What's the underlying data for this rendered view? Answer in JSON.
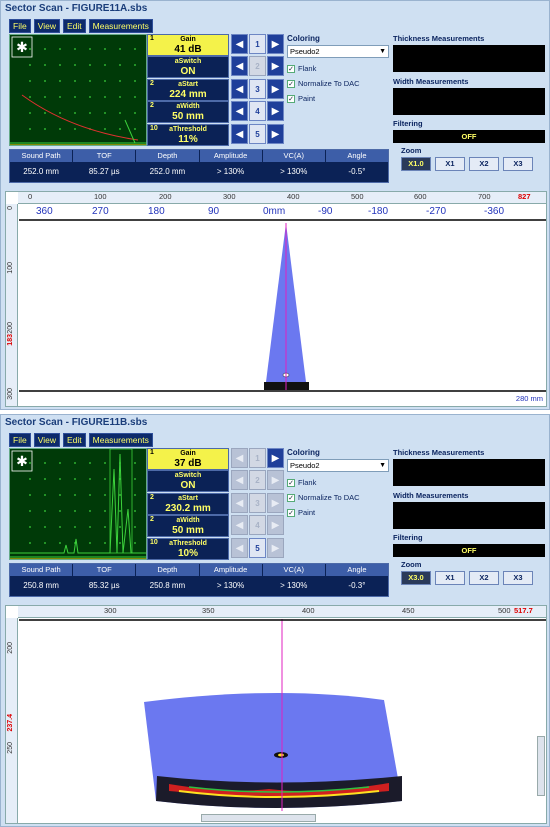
{
  "menu": [
    "File",
    "View",
    "Edit",
    "Measurements"
  ],
  "panels": [
    {
      "title": "Sector Scan - FIGURE11A.sbs",
      "params": [
        {
          "num": "1",
          "label": "Gain",
          "value": "41 dB"
        },
        {
          "num": "",
          "label": "aSwitch",
          "value": "ON"
        },
        {
          "num": "2",
          "label": "aStart",
          "value": "224 mm"
        },
        {
          "num": "2",
          "label": "aWidth",
          "value": "50 mm"
        },
        {
          "num": "10",
          "label": "aThreshold",
          "value": "11%"
        }
      ],
      "nav_digits": [
        "1",
        "2",
        "3",
        "4",
        "5"
      ],
      "coloring_label": "Coloring",
      "coloring_value": "Pseudo2",
      "checks": [
        "Flank",
        "Normalize To DAC",
        "Paint"
      ],
      "thickness_label": "Thickness Measurements",
      "width_label": "Width Measurements",
      "filtering_label": "Filtering",
      "filtering_value": "OFF",
      "zoom_label": "Zoom",
      "zoom": [
        "X1.0",
        "X1",
        "X2",
        "X3"
      ],
      "meas_headers": [
        "Sound Path",
        "TOF",
        "Depth",
        "Amplitude",
        "VC(A)",
        "Angle"
      ],
      "meas_values": [
        "252.0 mm",
        "85.27 µs",
        "252.0 mm",
        "> 130%",
        "> 130%",
        "-0.5°"
      ],
      "hruler": [
        "0",
        "100",
        "200",
        "300",
        "400",
        "500",
        "600",
        "700"
      ],
      "hruler_red": "827",
      "angles": [
        "360",
        "270",
        "180",
        "90",
        "0mm",
        "-90",
        "-180",
        "-270",
        "-360"
      ],
      "vruler": [
        "0",
        "100",
        "200",
        "300"
      ],
      "vruler_red": "183",
      "range_label": "280 mm",
      "colors": {
        "beam": "#6b78f0",
        "cursor": "#e020c0"
      }
    },
    {
      "title": "Sector Scan - FIGURE11B.sbs",
      "params": [
        {
          "num": "1",
          "label": "Gain",
          "value": "37 dB"
        },
        {
          "num": "",
          "label": "aSwitch",
          "value": "ON"
        },
        {
          "num": "2",
          "label": "aStart",
          "value": "230.2 mm"
        },
        {
          "num": "2",
          "label": "aWidth",
          "value": "50 mm"
        },
        {
          "num": "10",
          "label": "aThreshold",
          "value": "10%"
        }
      ],
      "nav_digits": [
        "1",
        "2",
        "3",
        "4",
        "5"
      ],
      "coloring_label": "Coloring",
      "coloring_value": "Pseudo2",
      "checks": [
        "Flank",
        "Normalize To DAC",
        "Paint"
      ],
      "thickness_label": "Thickness Measurements",
      "width_label": "Width Measurements",
      "filtering_label": "Filtering",
      "filtering_value": "OFF",
      "zoom_label": "Zoom",
      "zoom": [
        "X3.0",
        "X1",
        "X2",
        "X3"
      ],
      "meas_headers": [
        "Sound Path",
        "TOF",
        "Depth",
        "Amplitude",
        "VC(A)",
        "Angle"
      ],
      "meas_values": [
        "250.8 mm",
        "85.32 µs",
        "250.8 mm",
        "> 130%",
        "> 130%",
        "-0.3°"
      ],
      "hruler": [
        "300",
        "350",
        "400",
        "450",
        "500"
      ],
      "hruler_red": "517.7",
      "vruler": [
        "200",
        "250"
      ],
      "vruler_red": "237.4",
      "colors": {
        "beam": "#6b78f0",
        "cursor": "#e020c0"
      }
    }
  ]
}
